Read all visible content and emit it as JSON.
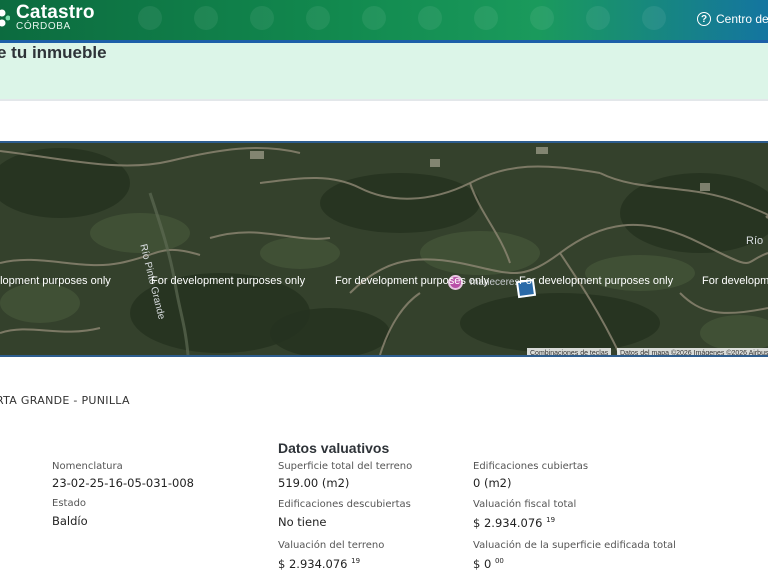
{
  "header": {
    "brand_title": "Catastro",
    "brand_subtitle": "CÓRDOBA",
    "help_label": "Centro de a",
    "icons": [
      "logo-icon",
      "help-circle-icon"
    ],
    "colors": {
      "green": "#128a4f",
      "blue_bar": "#1d5fa8"
    }
  },
  "banner": {
    "title": "e tu inmueble",
    "background": "#dcf5e8"
  },
  "map": {
    "watermarks": [
      "elopment purposes only",
      "For development purposes only",
      "For development purposes only",
      "For development purposes only",
      "For developm"
    ],
    "labels": {
      "river_main": "Río Pinto Grande",
      "river_right": "Río",
      "place": "maneceres"
    },
    "attribution": {
      "shortcuts": "Combinaciones de teclas",
      "data": "Datos del mapa ©2026 Imágenes ©2026 Airbus"
    }
  },
  "property": {
    "location": "RTA GRANDE - PUNILLA",
    "section_title": "Datos valuativos",
    "fields": [
      {
        "label": "Nomenclatura",
        "value": "23-02-25-16-05-031-008"
      },
      {
        "label": "Estado",
        "value": "Baldío"
      },
      {
        "label": "Superficie total del terreno",
        "value": "519.00 (m2)"
      },
      {
        "label": "Edificaciones descubiertas",
        "value": "No tiene"
      },
      {
        "label": "Valuación del terreno",
        "value": "$ 2.934.076",
        "cents": "19"
      },
      {
        "label": "Edificaciones cubiertas",
        "value": "0 (m2)"
      },
      {
        "label": "Valuación fiscal total",
        "value": "$ 2.934.076",
        "cents": "19"
      },
      {
        "label": "Valuación de la superficie edificada total",
        "value": "$ 0",
        "cents": "00"
      }
    ]
  }
}
